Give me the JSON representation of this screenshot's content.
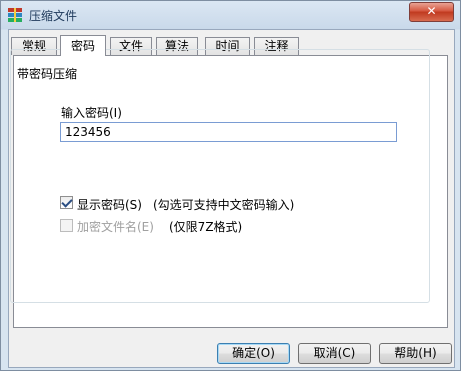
{
  "window": {
    "title": "压缩文件",
    "close_label": "✕"
  },
  "tabs": [
    {
      "label": "常规"
    },
    {
      "label": "密码"
    },
    {
      "label": "文件"
    },
    {
      "label": "算法"
    },
    {
      "label": "时间"
    },
    {
      "label": "注释"
    }
  ],
  "active_tab": "密码",
  "group": {
    "title": "带密码压缩",
    "password_label": "输入密码(I)",
    "password_value": "123456",
    "show_password": {
      "label": "显示密码(S)",
      "checked": true
    },
    "show_password_hint": "(勾选可支持中文密码输入)",
    "encrypt_names": {
      "label": "加密文件名(E)",
      "checked": false,
      "enabled": false
    },
    "encrypt_names_hint": "(仅限7Z格式)"
  },
  "buttons": {
    "ok": "确定(O)",
    "cancel": "取消(C)",
    "help": "帮助(H)"
  },
  "colors": {
    "title_text": "#1e395b",
    "close_red": "#c0391f",
    "input_border": "#7a9cd3"
  }
}
